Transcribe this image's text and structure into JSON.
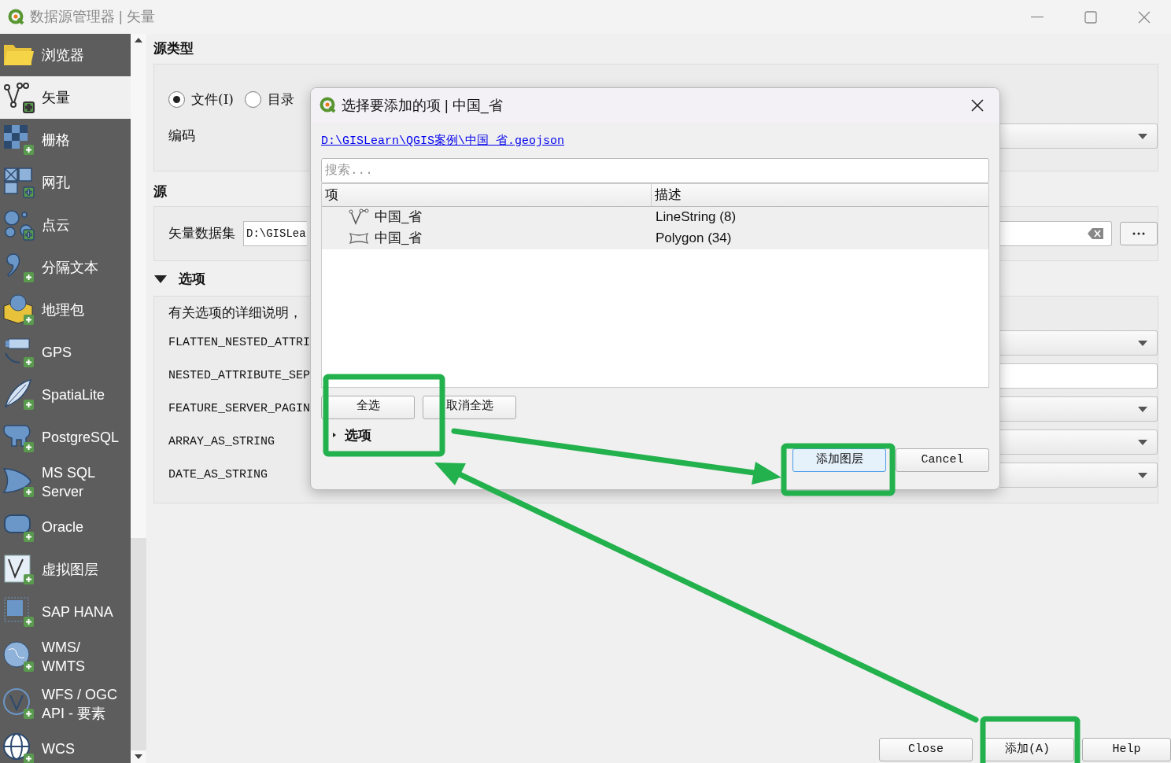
{
  "window": {
    "title": "数据源管理器 | 矢量"
  },
  "sidebar": {
    "items": [
      {
        "label": "浏览器",
        "selected": false
      },
      {
        "label": "矢量",
        "selected": true
      },
      {
        "label": "栅格",
        "selected": false
      },
      {
        "label": "网孔",
        "selected": false
      },
      {
        "label": "点云",
        "selected": false
      },
      {
        "label": "分隔文本",
        "selected": false
      },
      {
        "label": "地理包",
        "selected": false
      },
      {
        "label": "GPS",
        "selected": false
      },
      {
        "label": "SpatiaLite",
        "selected": false
      },
      {
        "label": "PostgreSQL",
        "selected": false
      },
      {
        "label": "MS SQL Server",
        "selected": false
      },
      {
        "label": "Oracle",
        "selected": false
      },
      {
        "label": "虚拟图层",
        "selected": false
      },
      {
        "label": "SAP HANA",
        "selected": false
      },
      {
        "label": "WMS/\nWMTS",
        "selected": false
      },
      {
        "label": "WFS / OGC API - 要素",
        "selected": false
      },
      {
        "label": "WCS",
        "selected": false
      }
    ]
  },
  "source_type": {
    "heading": "源类型",
    "radios": [
      {
        "label": "文件(I)",
        "selected": true
      },
      {
        "label": "目录",
        "selected": false
      }
    ],
    "encoding_label": "编码"
  },
  "source": {
    "heading": "源",
    "dataset_label": "矢量数据集",
    "dataset_value": "D:\\GISLea"
  },
  "options": {
    "heading": "选项",
    "expanded": true,
    "description": "有关选项的详细说明，",
    "rows": [
      {
        "label": "FLATTEN_NESTED_ATTRI",
        "kind": "dropdown"
      },
      {
        "label": "NESTED_ATTRIBUTE_SEP",
        "kind": "text"
      },
      {
        "label": "FEATURE_SERVER_PAGIN",
        "kind": "dropdown"
      },
      {
        "label": "ARRAY_AS_STRING",
        "kind": "dropdown"
      },
      {
        "label": "DATE_AS_STRING",
        "kind": "dropdown"
      }
    ]
  },
  "buttons": [
    {
      "label": "Close"
    },
    {
      "label": "添加(A)"
    },
    {
      "label": "Help"
    }
  ],
  "dialog": {
    "title": "选择要添加的项 | 中国_省",
    "path": "D:\\GISLearn\\QGIS案例\\中国_省.geojson",
    "search": {
      "placeholder": "搜索..."
    },
    "columns": [
      "项",
      "描述"
    ],
    "rows": [
      {
        "kind": "line",
        "name": "中国_省",
        "description": "LineString (8)",
        "selected": true
      },
      {
        "kind": "polygon",
        "name": "中国_省",
        "description": "Polygon (34)",
        "selected": true
      }
    ],
    "select_buttons": [
      "全选",
      "取消全选"
    ],
    "options_toggle": {
      "label": "选项",
      "expanded": false
    },
    "buttons": [
      {
        "label": "添加图层",
        "default": true
      },
      {
        "label": "Cancel",
        "default": false
      }
    ]
  }
}
